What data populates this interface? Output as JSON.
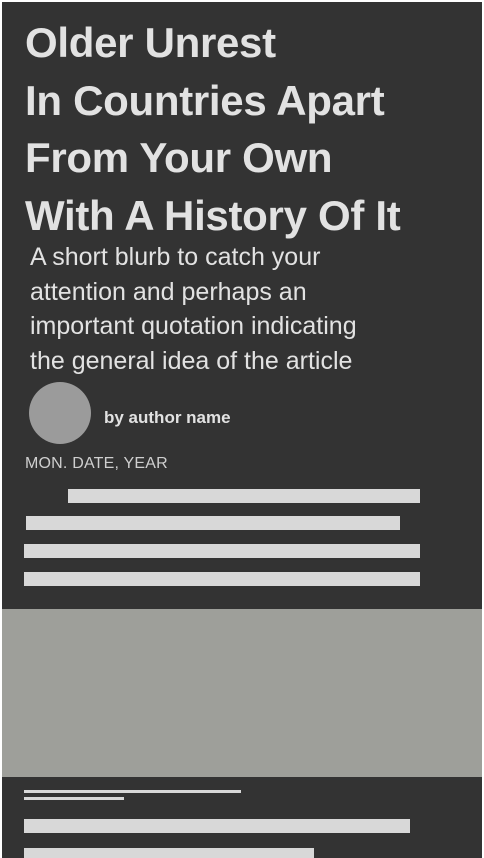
{
  "article": {
    "headline_lines": [
      "Older Unrest",
      "In Countries Apart",
      "From Your Own",
      "With A History Of It"
    ],
    "blurb_lines": [
      "A short blurb to catch your",
      "attention and perhaps an",
      "important quotation indicating",
      "the general idea of the article"
    ],
    "byline": "by author name",
    "date": "MON. DATE, YEAR"
  },
  "colors": {
    "background": "#333333",
    "text": "#e2e2e2",
    "placeholder_bar": "#d8d8d8",
    "avatar": "#9b9b9b",
    "image_placeholder": "#9e9f9a"
  }
}
